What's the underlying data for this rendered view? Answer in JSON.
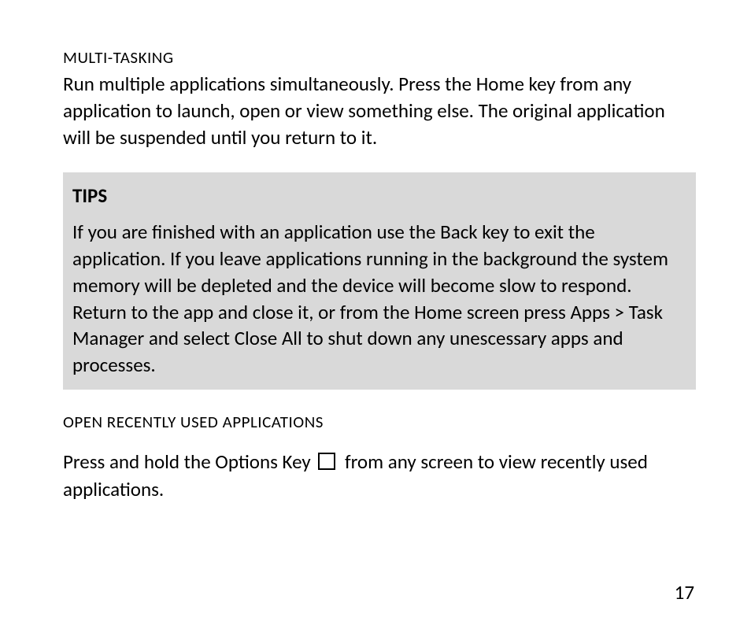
{
  "multi_tasking": {
    "heading": "MULTI-TASKING",
    "body": "Run multiple applications simultaneously. Press the Home key from any application to launch, open or view something else. The original application will be suspended until you return to it."
  },
  "tips": {
    "heading": "TIPS",
    "body": "If you are finished with an application use the Back key to exit the application. If you leave applications running in the background the system memory will be depleted and the device will become slow to respond. Return to the app and close it, or from the Home screen press Apps > Task Manager and select Close All to shut down any unescessary apps and processes."
  },
  "recent_apps": {
    "heading": "OPEN RECENTLY USED APPLICATIONS",
    "body_part1": "Press and hold the Options Key ",
    "body_part2": " from any screen to view recently used applications."
  },
  "page_number": "17"
}
